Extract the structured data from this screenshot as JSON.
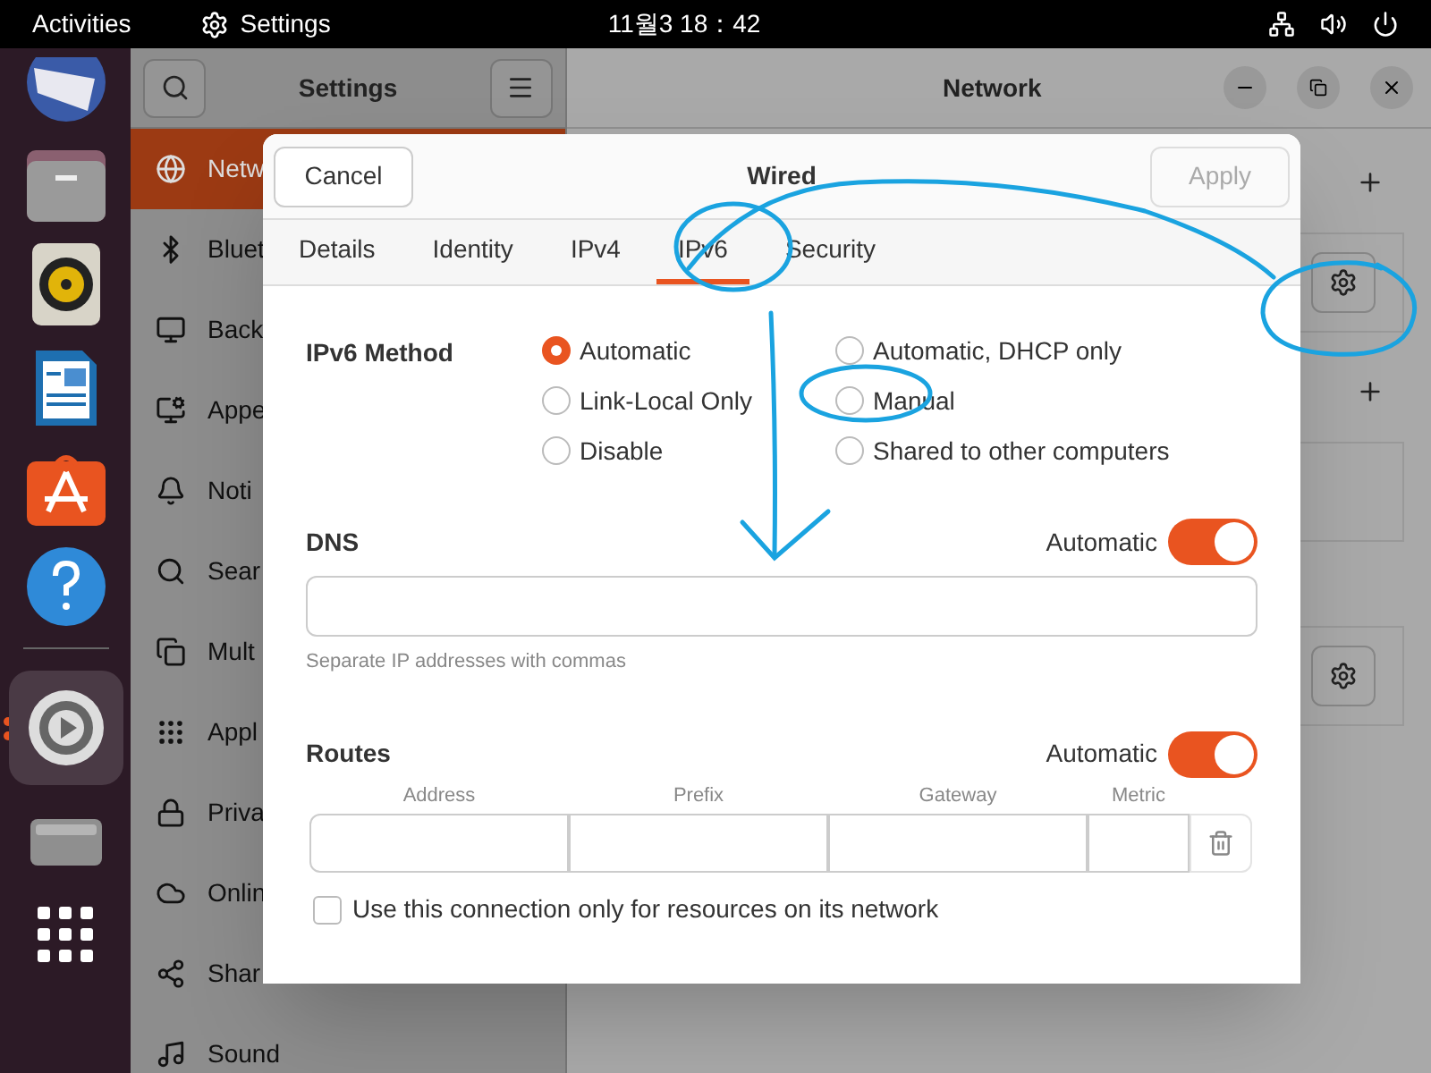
{
  "top_bar": {
    "activities": "Activities",
    "app_name": "Settings",
    "clock": "11월3  18：42"
  },
  "dock": [
    {
      "kind": "mail",
      "running": false
    },
    {
      "kind": "files",
      "running": false
    },
    {
      "kind": "speaker",
      "running": false
    },
    {
      "kind": "writer",
      "running": false
    },
    {
      "kind": "store",
      "running": false
    },
    {
      "kind": "help",
      "running": false
    },
    {
      "kind": "settings",
      "running": true
    },
    {
      "kind": "drive",
      "running": false
    },
    {
      "kind": "grid",
      "running": false
    }
  ],
  "sidebar": {
    "title": "Settings",
    "items": [
      {
        "label": "Netw",
        "selected": true
      },
      {
        "label": "Bluet",
        "selected": false
      },
      {
        "label": "Back",
        "selected": false
      },
      {
        "label": "Appe",
        "selected": false
      },
      {
        "label": "Noti",
        "selected": false
      },
      {
        "label": "Sear",
        "selected": false
      },
      {
        "label": "Mult",
        "selected": false
      },
      {
        "label": "Appl",
        "selected": false
      },
      {
        "label": "Priva",
        "selected": false
      },
      {
        "label": "Onlin",
        "selected": false
      },
      {
        "label": "Shar",
        "selected": false
      },
      {
        "label": "Sound",
        "selected": false
      }
    ]
  },
  "main": {
    "title": "Network"
  },
  "dialog": {
    "title": "Wired",
    "cancel": "Cancel",
    "apply": "Apply",
    "apply_disabled": true,
    "tabs": [
      {
        "label": "Details",
        "selected": false
      },
      {
        "label": "Identity",
        "selected": false
      },
      {
        "label": "IPv4",
        "selected": false
      },
      {
        "label": "IPv6",
        "selected": true
      },
      {
        "label": "Security",
        "selected": false
      }
    ],
    "method_label": "IPv6 Method",
    "methods": [
      {
        "label": "Automatic",
        "selected": true
      },
      {
        "label": "Link-Local Only",
        "selected": false
      },
      {
        "label": "Disable",
        "selected": false
      },
      {
        "label": "Automatic, DHCP only",
        "selected": false
      },
      {
        "label": "Manual",
        "selected": false
      },
      {
        "label": "Shared to other computers",
        "selected": false
      }
    ],
    "dns": {
      "label": "DNS",
      "auto_label": "Automatic",
      "on": true,
      "hint": "Separate IP addresses with commas"
    },
    "routes": {
      "label": "Routes",
      "auto_label": "Automatic",
      "on": true,
      "columns": [
        "Address",
        "Prefix",
        "Gateway",
        "Metric"
      ]
    },
    "only_local": {
      "label": "Use this connection only for resources on its network",
      "checked": false
    }
  }
}
